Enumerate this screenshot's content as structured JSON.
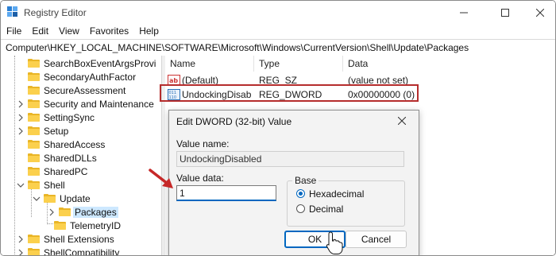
{
  "window": {
    "title": "Registry Editor",
    "menu": [
      "File",
      "Edit",
      "View",
      "Favorites",
      "Help"
    ],
    "address": "Computer\\HKEY_LOCAL_MACHINE\\SOFTWARE\\Microsoft\\Windows\\CurrentVersion\\Shell\\Update\\Packages"
  },
  "tree": {
    "items": [
      {
        "label": "SearchBoxEventArgsProvi",
        "expandable": false
      },
      {
        "label": "SecondaryAuthFactor",
        "expandable": false
      },
      {
        "label": "SecureAssessment",
        "expandable": false
      },
      {
        "label": "Security and Maintenance",
        "expandable": true
      },
      {
        "label": "SettingSync",
        "expandable": true
      },
      {
        "label": "Setup",
        "expandable": true
      },
      {
        "label": "SharedAccess",
        "expandable": false
      },
      {
        "label": "SharedDLLs",
        "expandable": false
      },
      {
        "label": "SharedPC",
        "expandable": false
      },
      {
        "label": "Shell",
        "expanded": true
      },
      {
        "label": "Update",
        "expanded": true
      },
      {
        "label": "Packages",
        "expandable": true,
        "selected": true
      },
      {
        "label": "TelemetryID",
        "expandable": false
      },
      {
        "label": "Shell Extensions",
        "expandable": true
      },
      {
        "label": "ShellCompatibility",
        "expandable": true
      }
    ]
  },
  "list": {
    "columns": [
      "Name",
      "Type",
      "Data"
    ],
    "rows": [
      {
        "name": "(Default)",
        "type": "REG_SZ",
        "data": "(value not set)",
        "icon": "string-value-icon"
      },
      {
        "name": "UndockingDisab",
        "type": "REG_DWORD",
        "data": "0x00000000 (0)",
        "icon": "dword-value-icon"
      }
    ]
  },
  "dialog": {
    "title": "Edit DWORD (32-bit) Value",
    "value_name_label": "Value name:",
    "value_name": "UndockingDisabled",
    "value_data_label": "Value data:",
    "value_data": "1",
    "base_label": "Base",
    "base_options": [
      "Hexadecimal",
      "Decimal"
    ],
    "base_selected": "Hexadecimal",
    "ok_label": "OK",
    "cancel_label": "Cancel"
  },
  "colors": {
    "highlight_border": "#b52d2d",
    "arrow": "#c62828",
    "accent": "#0067c0",
    "folder": "#fbd04d"
  }
}
